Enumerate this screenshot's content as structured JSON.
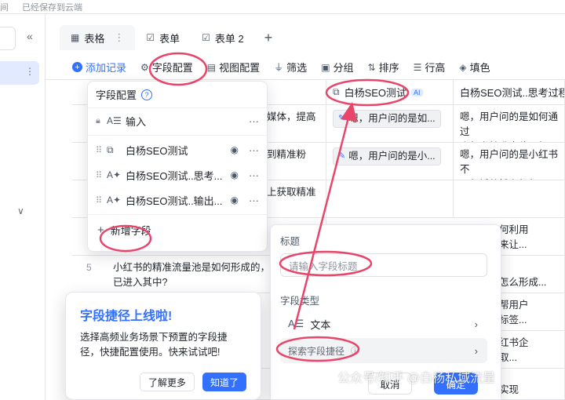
{
  "topbar": {
    "left_text": "间",
    "status": "已经保存到云端"
  },
  "tabs": [
    {
      "label": "表格",
      "icon": "grid-icon",
      "more": "⋮"
    },
    {
      "label": "表单",
      "icon": "form-icon"
    },
    {
      "label": "表单 2",
      "icon": "form-icon"
    }
  ],
  "tab_add": "+",
  "toolbar": {
    "add_record": "添加记录",
    "field_config": "字段配置",
    "view_config": "视图配置",
    "filter": "筛选",
    "group": "分组",
    "sort": "排序",
    "row_height": "行高",
    "fill": "填色"
  },
  "columns": {
    "col2": "白杨SEO测试",
    "col2_badge": "AI",
    "col3": "白杨SEO测试..思考过程"
  },
  "rows": [
    {
      "c1_tail": "媒体，提高",
      "c2": "嗯，用户问的是如...",
      "c3": "嗯，用户问的是如何通过\n小红书精准定位目标受..."
    },
    {
      "c1_tail": "到精准粉",
      "c2": "嗯，用户问的是小...",
      "c3": "嗯，用户问的是小红书不\n同领域的博主如何吸引..."
    },
    {
      "c1_tail": "上获取精准",
      "c2": "",
      "c3": ""
    },
    {
      "c1_tail": "",
      "c2": "",
      "c3": "要知道如何利用\n要索算法来让..."
    },
    {
      "num": "5",
      "c1": "小红书的精准流量池是如何形成的，\n已进入其中?",
      "c3": "小红书是怎么形成..."
    },
    {
      "c3": "现在需要帮用户\n兑提兴趣标签..."
    },
    {
      "c1_tail": "准",
      "c3": "问的是小红书企\n营才能获取..."
    },
    {
      "c1_tail": "准",
      "c3": "些达人来实现"
    }
  ],
  "field_config_menu": {
    "title": "字段配置",
    "help": "?",
    "fields": [
      {
        "label": "输入",
        "locked": true
      },
      {
        "label": "白杨SEO测试",
        "visible": true
      },
      {
        "label": "白杨SEO测试..思考...",
        "visible": true
      },
      {
        "label": "白杨SEO测试..输出...",
        "visible": true
      }
    ],
    "add_field": "新增字段",
    "more": "···",
    "eye": "◉"
  },
  "new_field_panel": {
    "title_label": "标题",
    "title_placeholder": "请输入字段标题",
    "type_label": "字段类型",
    "options": [
      {
        "label": "文本",
        "icon": "text-type-icon"
      },
      {
        "label": "探索字段捷径",
        "icon": "shortcut-icon",
        "info": "ⓘ"
      }
    ],
    "cancel": "取消",
    "confirm": "确定"
  },
  "tip_card": {
    "title": "字段捷径上线啦!",
    "body": "选择高频业务场景下预置的字段捷径，快捷配置使用。快来试试吧!",
    "learn_more": "了解更多",
    "got_it": "知道了"
  },
  "watermark": "公众号/知乎 @白杨私域流量",
  "colors": {
    "accent": "#3370ff",
    "annotation": "#e8456b"
  }
}
